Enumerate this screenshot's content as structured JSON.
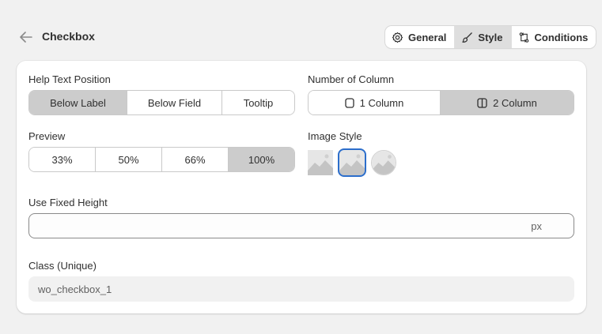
{
  "header": {
    "title": "Checkbox",
    "tabs": [
      {
        "label": "General",
        "icon": "gear-icon",
        "active": false
      },
      {
        "label": "Style",
        "icon": "paintbrush-icon",
        "active": true
      },
      {
        "label": "Conditions",
        "icon": "branch-icon",
        "active": false
      }
    ]
  },
  "help_text_position": {
    "label": "Help Text Position",
    "options": [
      "Below Label",
      "Below Field",
      "Tooltip"
    ],
    "selected": "Below Label"
  },
  "number_of_column": {
    "label": "Number of Column",
    "options": [
      "1 Column",
      "2 Column"
    ],
    "selected": "2 Column"
  },
  "preview": {
    "label": "Preview",
    "options": [
      "33%",
      "50%",
      "66%",
      "100%"
    ],
    "selected": "100%"
  },
  "image_style": {
    "label": "Image Style",
    "options": [
      "square",
      "rounded",
      "circle"
    ],
    "selected": "rounded"
  },
  "fixed_height": {
    "label": "Use Fixed Height",
    "value": "",
    "suffix": "px"
  },
  "class_unique": {
    "label": "Class (Unique)",
    "value": "wo_checkbox_1"
  },
  "colors": {
    "accent": "#2c6ecb",
    "selected_bg": "#cccccc",
    "page_bg": "#f1f1f1"
  }
}
